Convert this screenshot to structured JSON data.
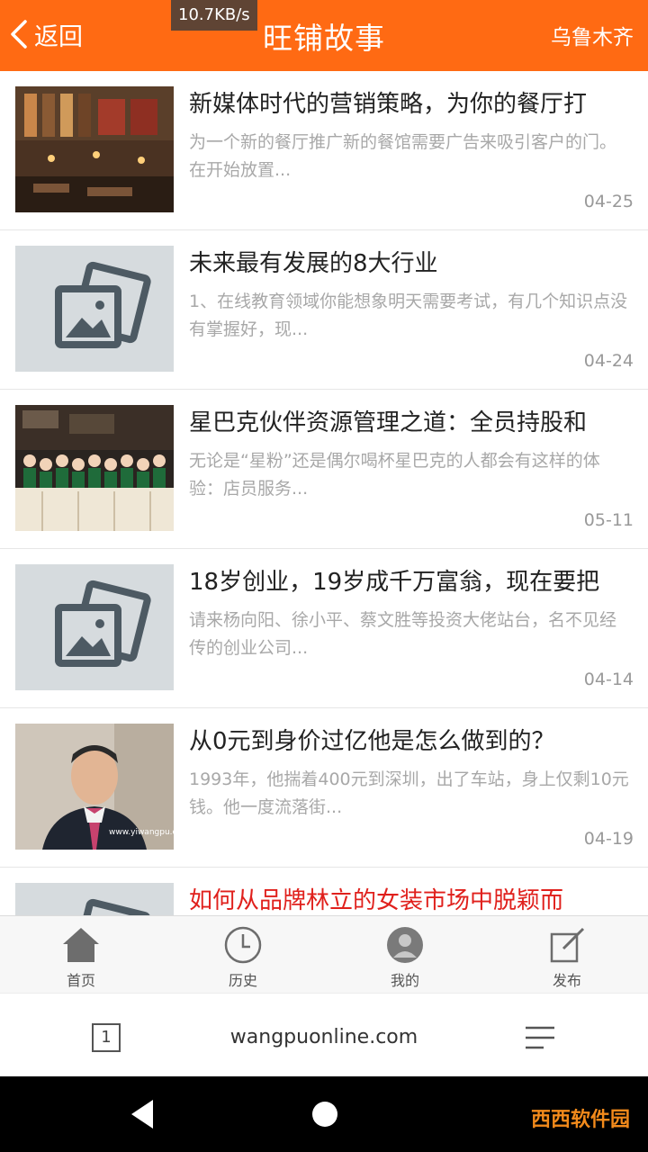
{
  "header": {
    "back_label": "返回",
    "title": "旺铺故事",
    "city": "乌鲁木齐",
    "net_speed": "10.7KB/s",
    "background": "#ff6a13"
  },
  "articles": [
    {
      "title": "新媒体时代的营销策略，为你的餐厅打",
      "summary": "为一个新的餐厅推广新的餐馆需要广告来吸引客户的门。在开始放置...",
      "date": "04-25",
      "image": "restaurant-photo"
    },
    {
      "title": "未来最有发展的8大行业",
      "summary": "1、在线教育领域你能想象明天需要考试，有几个知识点没有掌握好，现...",
      "date": "04-24",
      "image": "placeholder-image-icon"
    },
    {
      "title": "星巴克伙伴资源管理之道：全员持股和",
      "summary": "无论是“星粉”还是偶尔喝杯星巴克的人都会有这样的体验：店员服务...",
      "date": "05-11",
      "image": "starbucks-staff-photo"
    },
    {
      "title": "18岁创业，19岁成千万富翁，现在要把",
      "summary": "请来杨向阳、徐小平、蔡文胜等投资大佬站台，名不见经传的创业公司...",
      "date": "04-14",
      "image": "placeholder-image-icon"
    },
    {
      "title": "从0元到身价过亿他是怎么做到的？",
      "summary": "1993年，他揣着400元到深圳，出了车站，身上仅剩10元钱。他一度流落街...",
      "date": "04-19",
      "image": "businessman-photo",
      "image_caption": "www.yiwangpu.com"
    },
    {
      "title": "如何从品牌林立的女装市场中脱颖而",
      "summary": "",
      "date": "",
      "image": "placeholder-image-icon",
      "title_color": "#e0201c"
    }
  ],
  "tabs": [
    {
      "label": "首页",
      "icon": "home-icon"
    },
    {
      "label": "历史",
      "icon": "clock-icon"
    },
    {
      "label": "我的",
      "icon": "user-icon"
    },
    {
      "label": "发布",
      "icon": "edit-icon"
    }
  ],
  "browser": {
    "tab_count": "1",
    "url": "wangpuonline.com"
  },
  "watermark": "西西软件园"
}
